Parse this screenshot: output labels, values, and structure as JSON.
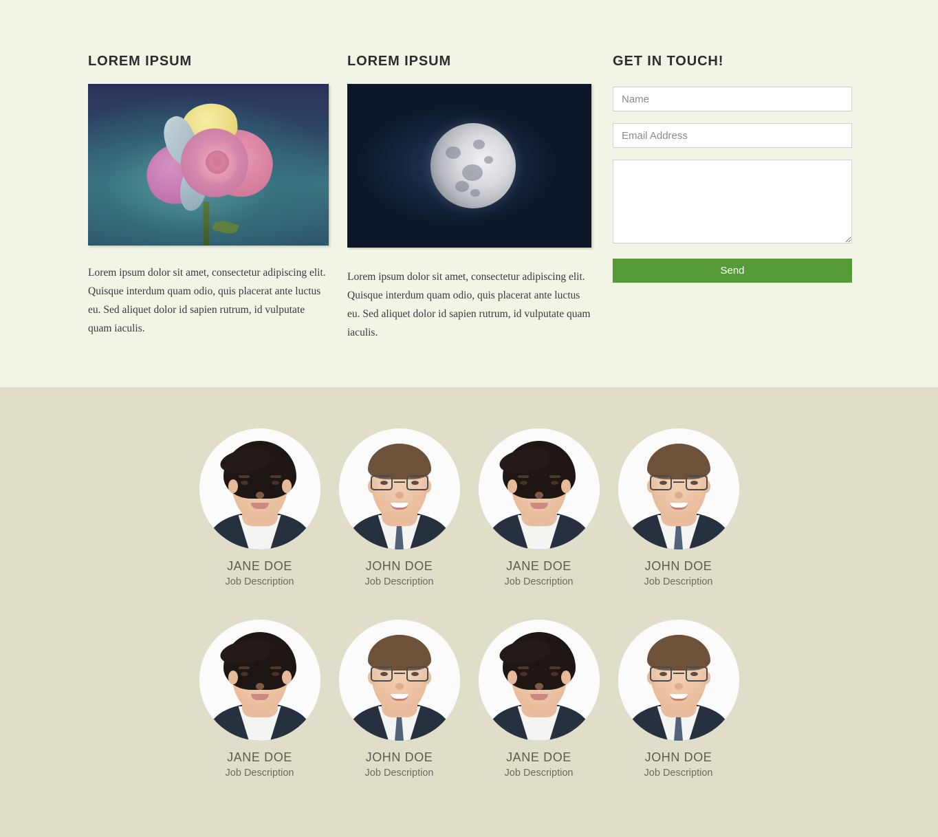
{
  "theme": {
    "top_background": "#f2f5e6",
    "bottom_background": "#e0ddc9",
    "accent_green": "#559b38",
    "heading_color": "#2d2d2d",
    "body_text_color": "#3a3a3a",
    "name_color": "#5c5c52"
  },
  "columns": [
    {
      "title": "LOREM IPSUM",
      "image": "rose-photo",
      "body": "Lorem ipsum dolor sit amet, consectetur adipiscing elit. Quisque interdum quam odio, quis placerat ante luctus eu. Sed aliquet dolor id sapien rutrum, id vulputate quam iaculis."
    },
    {
      "title": "LOREM IPSUM",
      "image": "moon-photo",
      "body": "Lorem ipsum dolor sit amet, consectetur adipiscing elit. Quisque interdum quam odio, quis placerat ante luctus eu. Sed aliquet dolor id sapien rutrum, id vulputate quam iaculis."
    }
  ],
  "contact_form": {
    "title": "GET IN TOUCH!",
    "name_placeholder": "Name",
    "name_value": "",
    "email_placeholder": "Email Address",
    "email_value": "",
    "message_placeholder": "",
    "message_value": "",
    "submit_label": "Send"
  },
  "team": [
    {
      "name": "JANE DOE",
      "job": "Job Description",
      "portrait": "woman-dark-hair"
    },
    {
      "name": "JOHN DOE",
      "job": "Job Description",
      "portrait": "man-glasses"
    },
    {
      "name": "JANE DOE",
      "job": "Job Description",
      "portrait": "woman-dark-hair"
    },
    {
      "name": "JOHN DOE",
      "job": "Job Description",
      "portrait": "man-glasses"
    },
    {
      "name": "JANE DOE",
      "job": "Job Description",
      "portrait": "woman-dark-hair"
    },
    {
      "name": "JOHN DOE",
      "job": "Job Description",
      "portrait": "man-glasses"
    },
    {
      "name": "JANE DOE",
      "job": "Job Description",
      "portrait": "woman-dark-hair"
    },
    {
      "name": "JOHN DOE",
      "job": "Job Description",
      "portrait": "man-glasses"
    }
  ]
}
